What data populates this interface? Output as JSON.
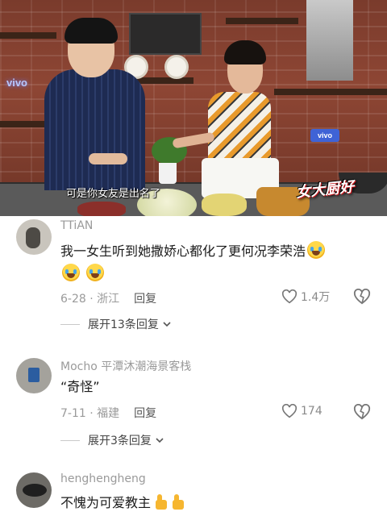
{
  "video": {
    "subtitle": "可是你女友是出名了",
    "neon_sign": "vivo",
    "sponsor_badge": "vivo",
    "show_logo": "女大厨好"
  },
  "comments": [
    {
      "username": "TTiAN",
      "text": "我一女生听到她撒娇心都化了更何况李荣浩",
      "emoji": "laughing-crying-emoji",
      "date": "6-28",
      "location": "浙江",
      "reply_label": "回复",
      "like_count": "1.4万",
      "expand_label": "展开13条回复"
    },
    {
      "username": "Mocho 平潭沐潮海景客栈",
      "text": "“奇怪”",
      "date": "7-11",
      "location": "福建",
      "reply_label": "回复",
      "like_count": "174",
      "expand_label": "展开3条回复"
    },
    {
      "username": "henghengheng",
      "text": "不愧为可爱教主",
      "emoji": "thumbs-up-emoji"
    }
  ],
  "colors": {
    "username": "#9a9a9a",
    "text": "#1b1b1b",
    "meta": "#9a9a9a",
    "emoji_face": "#ffd84a",
    "thumbs_up": "#f6b630"
  },
  "icons": [
    "heart-outline-icon",
    "broken-heart-icon",
    "chevron-down-icon"
  ]
}
